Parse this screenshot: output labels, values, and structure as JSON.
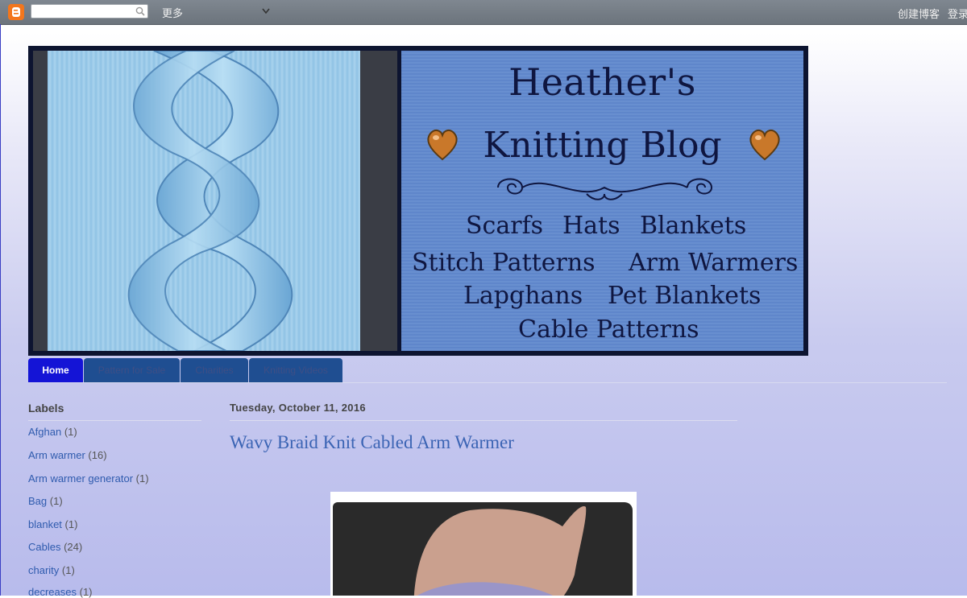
{
  "navbar": {
    "more_label": "更多",
    "create_blog_label": "创建博客",
    "login_label": "登录",
    "search_placeholder": ""
  },
  "header": {
    "title_line1": "Heather's",
    "title_line2": "Knitting Blog",
    "categories": [
      "Scarfs",
      "Hats",
      "Blankets",
      "Stitch Patterns",
      "Arm Warmers",
      "Lapghans",
      "Pet Blankets",
      "Cable Patterns"
    ]
  },
  "tabs": [
    {
      "label": "Home",
      "active": true
    },
    {
      "label": "Pattern for Sale",
      "active": false
    },
    {
      "label": "Charities",
      "active": false
    },
    {
      "label": "Knitting Videos",
      "active": false
    }
  ],
  "sidebar": {
    "title": "Labels",
    "items": [
      {
        "name": "Afghan",
        "count": "(1)"
      },
      {
        "name": "Arm warmer",
        "count": "(16)"
      },
      {
        "name": "Arm warmer generator",
        "count": "(1)"
      },
      {
        "name": "Bag",
        "count": "(1)"
      },
      {
        "name": "blanket",
        "count": "(1)"
      },
      {
        "name": "Cables",
        "count": "(24)"
      },
      {
        "name": "charity",
        "count": "(1)"
      },
      {
        "name": "decreases",
        "count": "(1)"
      }
    ]
  },
  "post": {
    "date": "Tuesday, October 11, 2016",
    "title": "Wavy Braid Knit Cabled Arm Warmer"
  },
  "colors": {
    "tab_active": "#1414d6",
    "tab_inactive": "#1f4e91",
    "link": "#2f5bae",
    "post_title": "#3b64b4",
    "blogger_orange": "#f3761c"
  },
  "icons": {
    "blogger": "blogger-logo-icon",
    "search": "search-icon",
    "dropdown": "chevron-down-icon",
    "heart": "heart-icon"
  }
}
